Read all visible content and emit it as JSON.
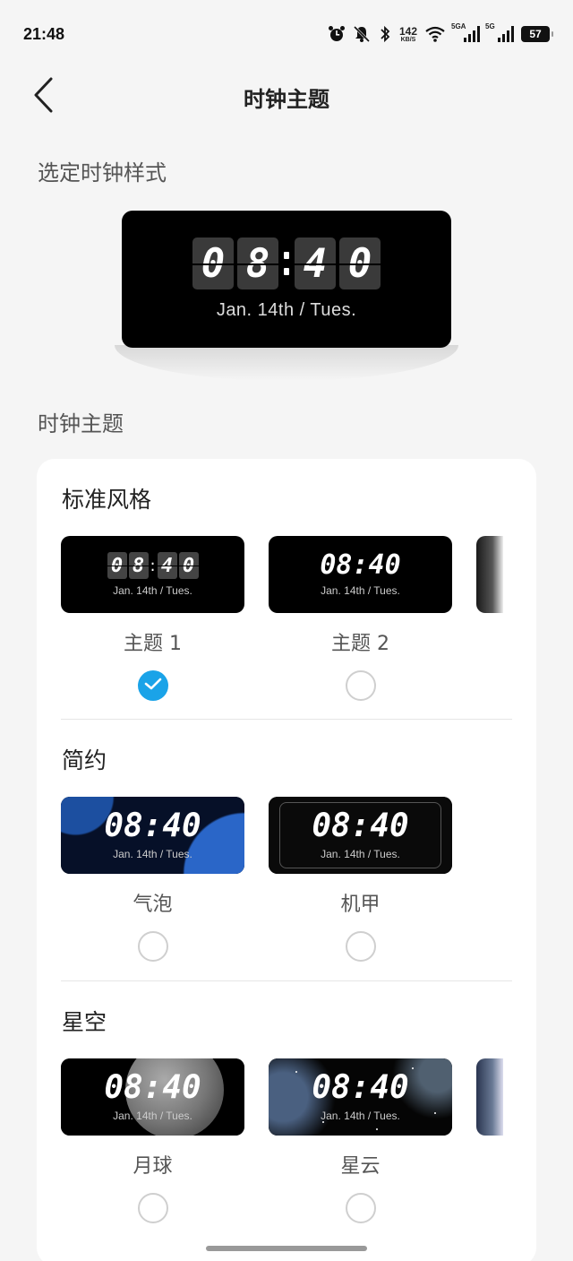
{
  "status_bar": {
    "time": "21:48",
    "net_speed_value": "142",
    "net_speed_unit": "KB/S",
    "signal1_label": "5GA",
    "signal2_label": "5G",
    "battery": "57"
  },
  "nav": {
    "title": "时钟主题"
  },
  "labels": {
    "select_style": "选定时钟样式",
    "clock_theme": "时钟主题"
  },
  "preview": {
    "digits": [
      "0",
      "8",
      "4",
      "0"
    ],
    "date": "Jan. 14th / Tues."
  },
  "groups": [
    {
      "title": "标准风格",
      "items": [
        {
          "name": "主题 1",
          "time": "08:40",
          "date": "Jan. 14th / Tues.",
          "selected": true
        },
        {
          "name": "主题 2",
          "time": "08:40",
          "date": "Jan. 14th / Tues.",
          "selected": false
        }
      ]
    },
    {
      "title": "简约",
      "items": [
        {
          "name": "气泡",
          "time": "08:40",
          "date": "Jan. 14th / Tues.",
          "selected": false
        },
        {
          "name": "机甲",
          "time": "08:40",
          "date": "Jan. 14th / Tues.",
          "selected": false
        }
      ]
    },
    {
      "title": "星空",
      "items": [
        {
          "name": "月球",
          "time": "08:40",
          "date": "Jan. 14th / Tues.",
          "selected": false
        },
        {
          "name": "星云",
          "time": "08:40",
          "date": "Jan. 14th / Tues.",
          "selected": false
        }
      ]
    }
  ],
  "colors": {
    "accent": "#1aa3e8",
    "background": "#f5f5f5",
    "panel": "#ffffff"
  }
}
